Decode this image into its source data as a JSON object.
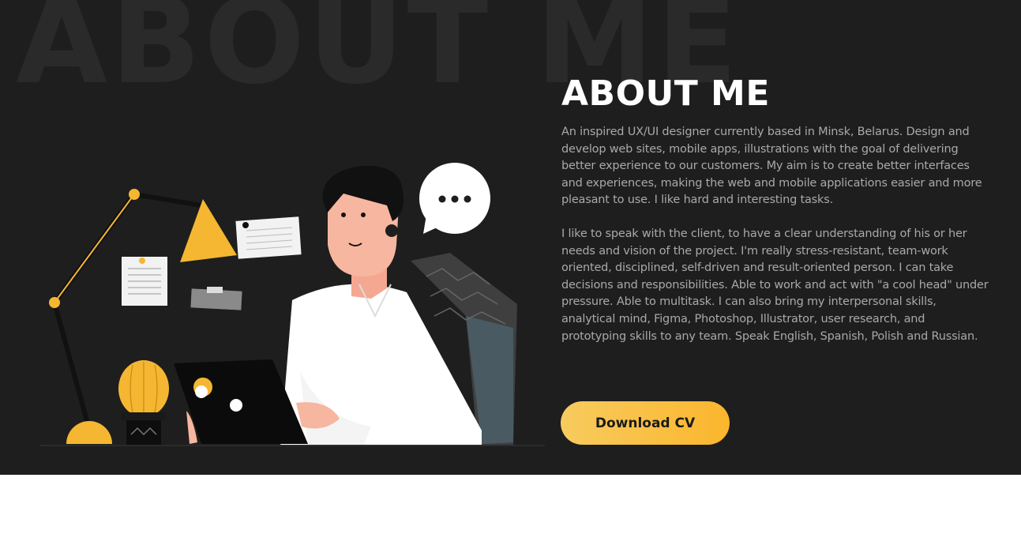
{
  "about": {
    "watermark": "ABOUT ME",
    "title": "ABOUT ME",
    "paragraph1": "An inspired UX/UI designer currently based in Minsk, Belarus. Design and develop web sites, mobile apps, illustrations with the goal of delivering better experience to our customers. My aim is to create better interfaces and experiences, making the web and mobile applications easier and more pleasant to use. I like hard and interesting tasks.",
    "paragraph2": "I like to speak with the client, to have a clear understanding of his or her needs and vision of the project.  I'm really stress-resistant, team-work oriented, disciplined, self-driven and result-oriented person. I can take decisions and responsibilities. Able to work and act with \"a cool head\" under pressure. Able to multitask. I can also bring my interpersonal skills, analytical mind, Figma, Photoshop, Illustrator, user research, and prototyping skills to any team. Speak English, Spanish, Polish and Russian.",
    "download_label": "Download CV"
  },
  "colors": {
    "background": "#1e1e1e",
    "accent": "#fbb62d",
    "text": "#a9a9a9",
    "heading": "#ffffff"
  },
  "illustration": {
    "icons": [
      "desk-lamp-icon",
      "cactus-icon",
      "laptop-icon",
      "speech-bubble-icon",
      "note-icon",
      "chair-icon",
      "designer-person-icon"
    ]
  }
}
